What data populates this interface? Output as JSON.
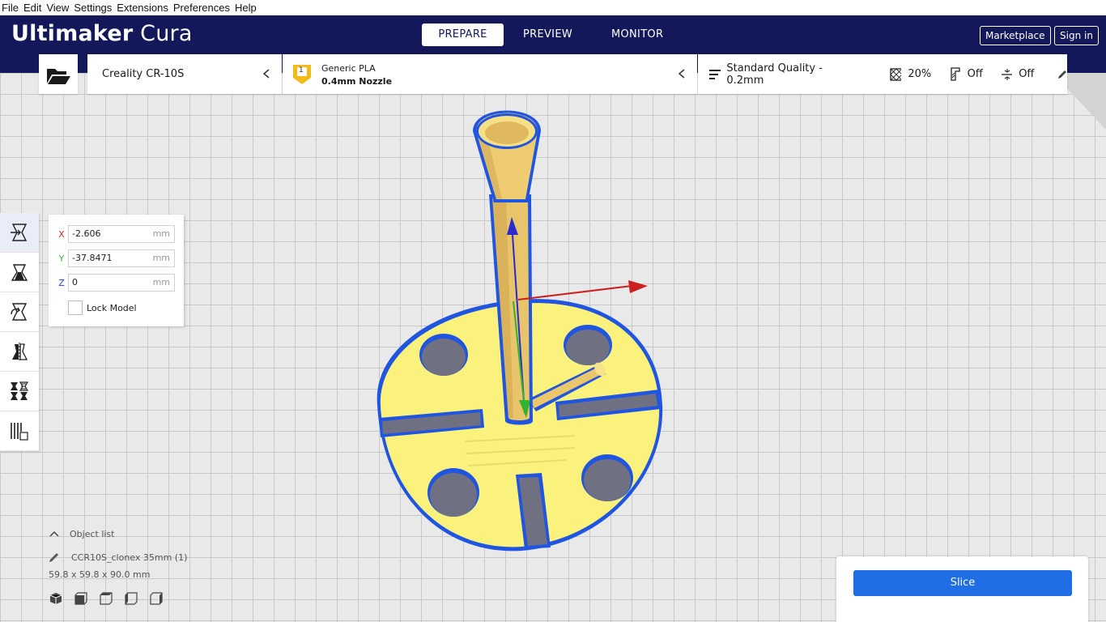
{
  "menu": [
    "File",
    "Edit",
    "View",
    "Settings",
    "Extensions",
    "Preferences",
    "Help"
  ],
  "header": {
    "brand_bold": "Ultimaker",
    "brand_light": "Cura",
    "stages": [
      "PREPARE",
      "PREVIEW",
      "MONITOR"
    ],
    "active_stage": "PREPARE",
    "marketplace": "Marketplace",
    "signin": "Sign in"
  },
  "printer": {
    "name": "Creality CR-10S"
  },
  "material": {
    "extruder_number": "1",
    "name": "Generic PLA",
    "nozzle": "0.4mm Nozzle",
    "accent": "#f3ba1a"
  },
  "print_settings": {
    "quality": "Standard Quality - 0.2mm",
    "infill": "20%",
    "support": "Off",
    "adhesion": "Off"
  },
  "tools": [
    "move-icon",
    "scale-icon",
    "rotate-icon",
    "mirror-icon",
    "per-model-settings-icon",
    "support-blocker-icon"
  ],
  "move_panel": {
    "x": {
      "label": "X",
      "value": "-2.606",
      "unit": "mm",
      "color": "#d42a2a"
    },
    "y": {
      "label": "Y",
      "value": "-37.8471",
      "unit": "mm",
      "color": "#3cb23c"
    },
    "z": {
      "label": "Z",
      "value": "0",
      "unit": "mm",
      "color": "#2a3fd4"
    },
    "lock_label": "Lock Model"
  },
  "object_list": {
    "title": "Object list",
    "object_name": "CCR10S_clonex 35mm (1)",
    "dimensions": "59.8 x 59.8 x 90.0 mm"
  },
  "view_buttons": [
    "3d-view-icon",
    "front-view-icon",
    "top-view-icon",
    "left-view-icon",
    "right-view-icon"
  ],
  "slice": {
    "label": "Slice",
    "color": "#1f6ee6"
  },
  "colors": {
    "header": "#12185a",
    "model": "#f9f07a",
    "outline": "#1f55e0"
  }
}
